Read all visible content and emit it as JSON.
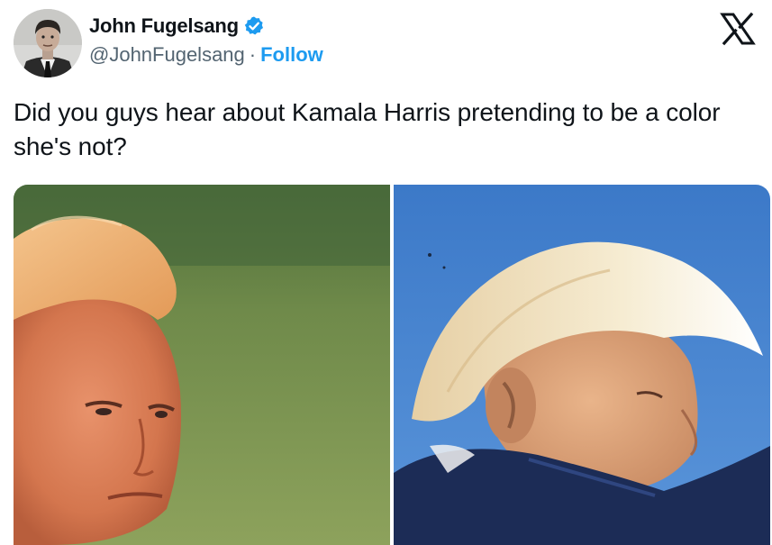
{
  "author": {
    "display_name": "John Fugelsang",
    "handle": "@JohnFugelsang",
    "separator": "·",
    "follow_label": "Follow",
    "verified": true
  },
  "platform": {
    "logo": "x-logo-icon"
  },
  "tweet": {
    "text": "Did you guys hear about Kamala Harris pretending to be a color she's not?"
  },
  "media": {
    "count": 2,
    "items": [
      {
        "subject": "man with orange-tinted face and blond hair, green background"
      },
      {
        "subject": "man with blond hair seen from behind, blue sky background"
      }
    ]
  },
  "colors": {
    "link_blue": "#1d9bf0",
    "text_primary": "#0f1419",
    "text_secondary": "#536471",
    "verified_blue": "#1d9bf0"
  }
}
